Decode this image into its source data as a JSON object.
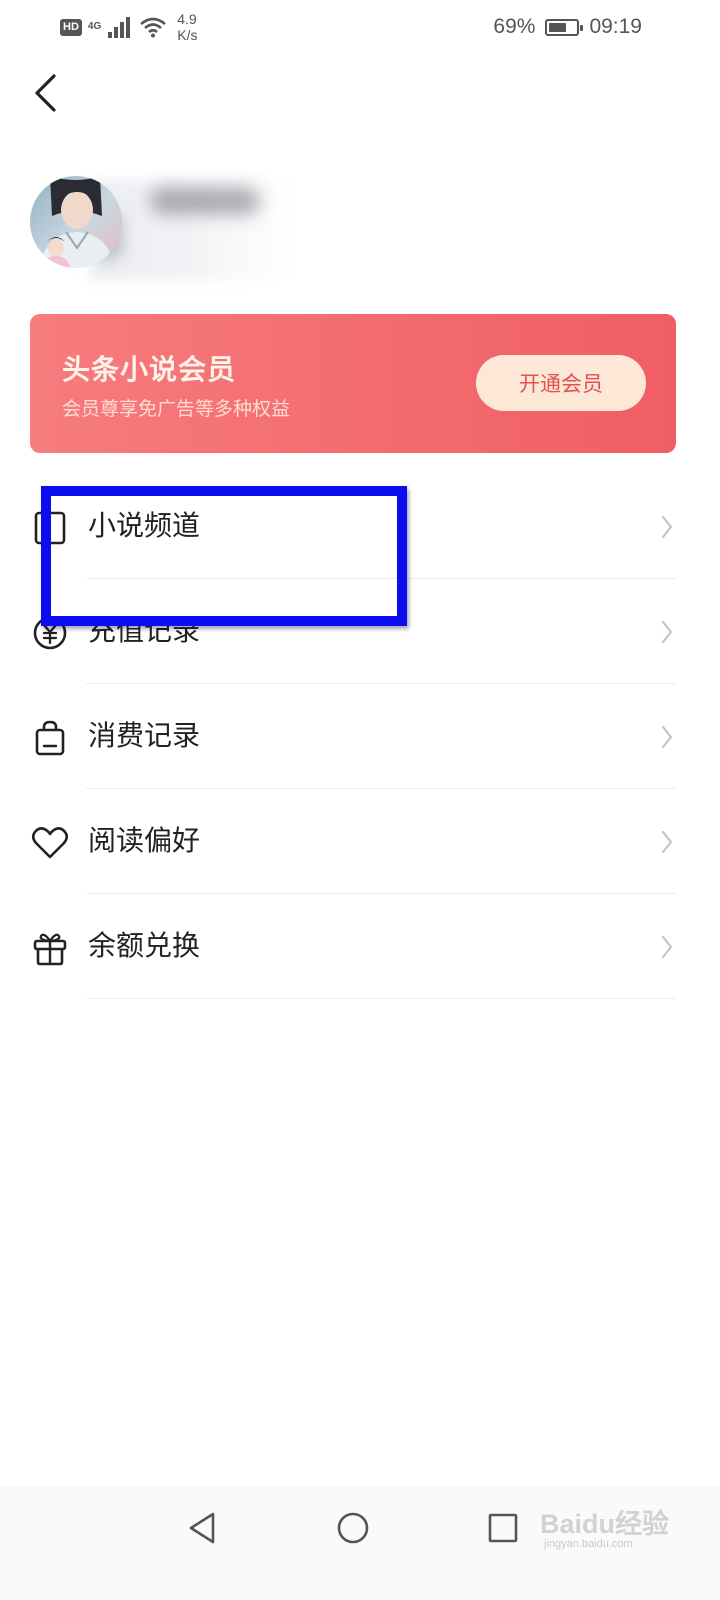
{
  "status_bar": {
    "hd": "HD",
    "network": "4G",
    "speed_value": "4.9",
    "speed_unit": "K/s",
    "battery_percent": "69%",
    "battery_level": 0.69,
    "time": "09:19"
  },
  "profile": {
    "avatar": "user-avatar-photo"
  },
  "vip": {
    "title": "头条小说会员",
    "subtitle": "会员尊享免广告等多种权益",
    "button_label": "开通会员",
    "colors": {
      "banner_start": "#f77c7e",
      "banner_end": "#ef5e63",
      "button_bg": "#fde7d6",
      "button_text": "#e2524f"
    }
  },
  "menu": {
    "items": [
      {
        "label": "小说频道",
        "icon": "book-icon"
      },
      {
        "label": "充值记录",
        "icon": "coin-icon"
      },
      {
        "label": "消费记录",
        "icon": "shopping-bag-icon"
      },
      {
        "label": "阅读偏好",
        "icon": "heart-icon"
      },
      {
        "label": "余额兑换",
        "icon": "gift-icon"
      }
    ]
  },
  "annotation": {
    "color": "#0c0cf0"
  },
  "nav_bar": {
    "buttons": [
      "back-triangle-icon",
      "home-circle-icon",
      "recents-square-icon"
    ]
  },
  "watermark": {
    "text": "Baidu经验",
    "url": "jingyan.baidu.com"
  }
}
